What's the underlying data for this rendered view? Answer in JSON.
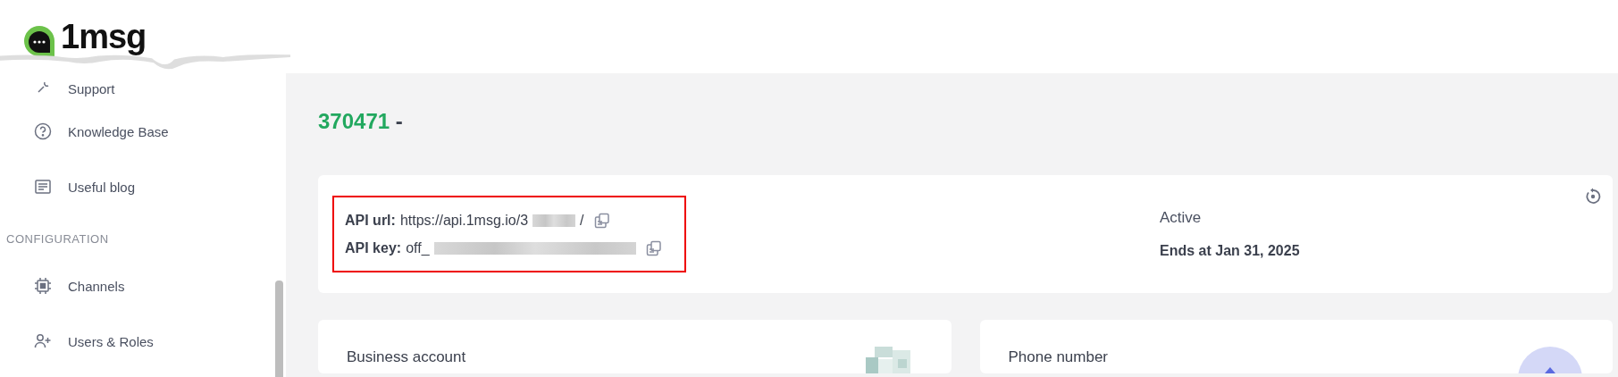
{
  "logo": {
    "text": "1msg"
  },
  "sidebar": {
    "items": [
      {
        "kind": "item",
        "label": "Support"
      },
      {
        "kind": "item",
        "label": "Knowledge Base"
      },
      {
        "kind": "item",
        "label": "Useful blog"
      },
      {
        "kind": "section",
        "label": "CONFIGURATION"
      },
      {
        "kind": "item",
        "label": "Channels"
      },
      {
        "kind": "item",
        "label": "Users & Roles"
      }
    ]
  },
  "page_title": {
    "id": "370471",
    "suffix": "-"
  },
  "api_card": {
    "url_label": "API url:",
    "url_value": "https://api.1msg.io/3",
    "url_end": "/",
    "key_label": "API key:",
    "key_value": "off_",
    "status": "Active",
    "ends": "Ends at Jan 31, 2025"
  },
  "cards": [
    {
      "title": "Business account",
      "kind": "qr"
    },
    {
      "title": "Phone number",
      "kind": "avatar"
    }
  ]
}
